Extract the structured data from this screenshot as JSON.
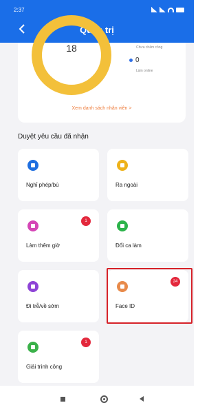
{
  "status_bar": {
    "time": "2:37"
  },
  "header": {
    "title": "Quản trị",
    "back_icon": "chevron-left-icon"
  },
  "stats": {
    "total": "18",
    "legend_top": "Chưa chấm công",
    "online_count": "0",
    "online_label": "Làm online",
    "view_link": "Xem danh sách nhân viên  >",
    "colors": {
      "donut": "#f3c03a",
      "online_dot": "#2f6fe6"
    }
  },
  "section": {
    "title": "Duyệt yêu cầu đã nhận"
  },
  "tiles": [
    {
      "label": "Nghỉ phép/bù",
      "icon": "calendar-icon",
      "color": "#1f6fe0",
      "badge": ""
    },
    {
      "label": "Ra ngoài",
      "icon": "door-exit-icon",
      "color": "#eeb21a",
      "badge": ""
    },
    {
      "label": "Làm thêm giờ",
      "icon": "overtime-clock-icon",
      "color": "#d546b6",
      "badge": "1"
    },
    {
      "label": "Đổi ca làm",
      "icon": "swap-shift-icon",
      "color": "#2cb34a",
      "badge": ""
    },
    {
      "label": "Đi trễ/về sớm",
      "icon": "late-early-icon",
      "color": "#8e44d6",
      "badge": ""
    },
    {
      "label": "Face ID",
      "icon": "face-id-icon",
      "color": "#e88a4a",
      "badge": "24"
    },
    {
      "label": "Giải trình công",
      "icon": "explanation-doc-icon",
      "color": "#3bb14a",
      "badge": "1"
    }
  ],
  "nav": {
    "recent_icon": "square-icon",
    "home_icon": "home-circle-icon",
    "back_icon": "back-triangle-icon"
  }
}
